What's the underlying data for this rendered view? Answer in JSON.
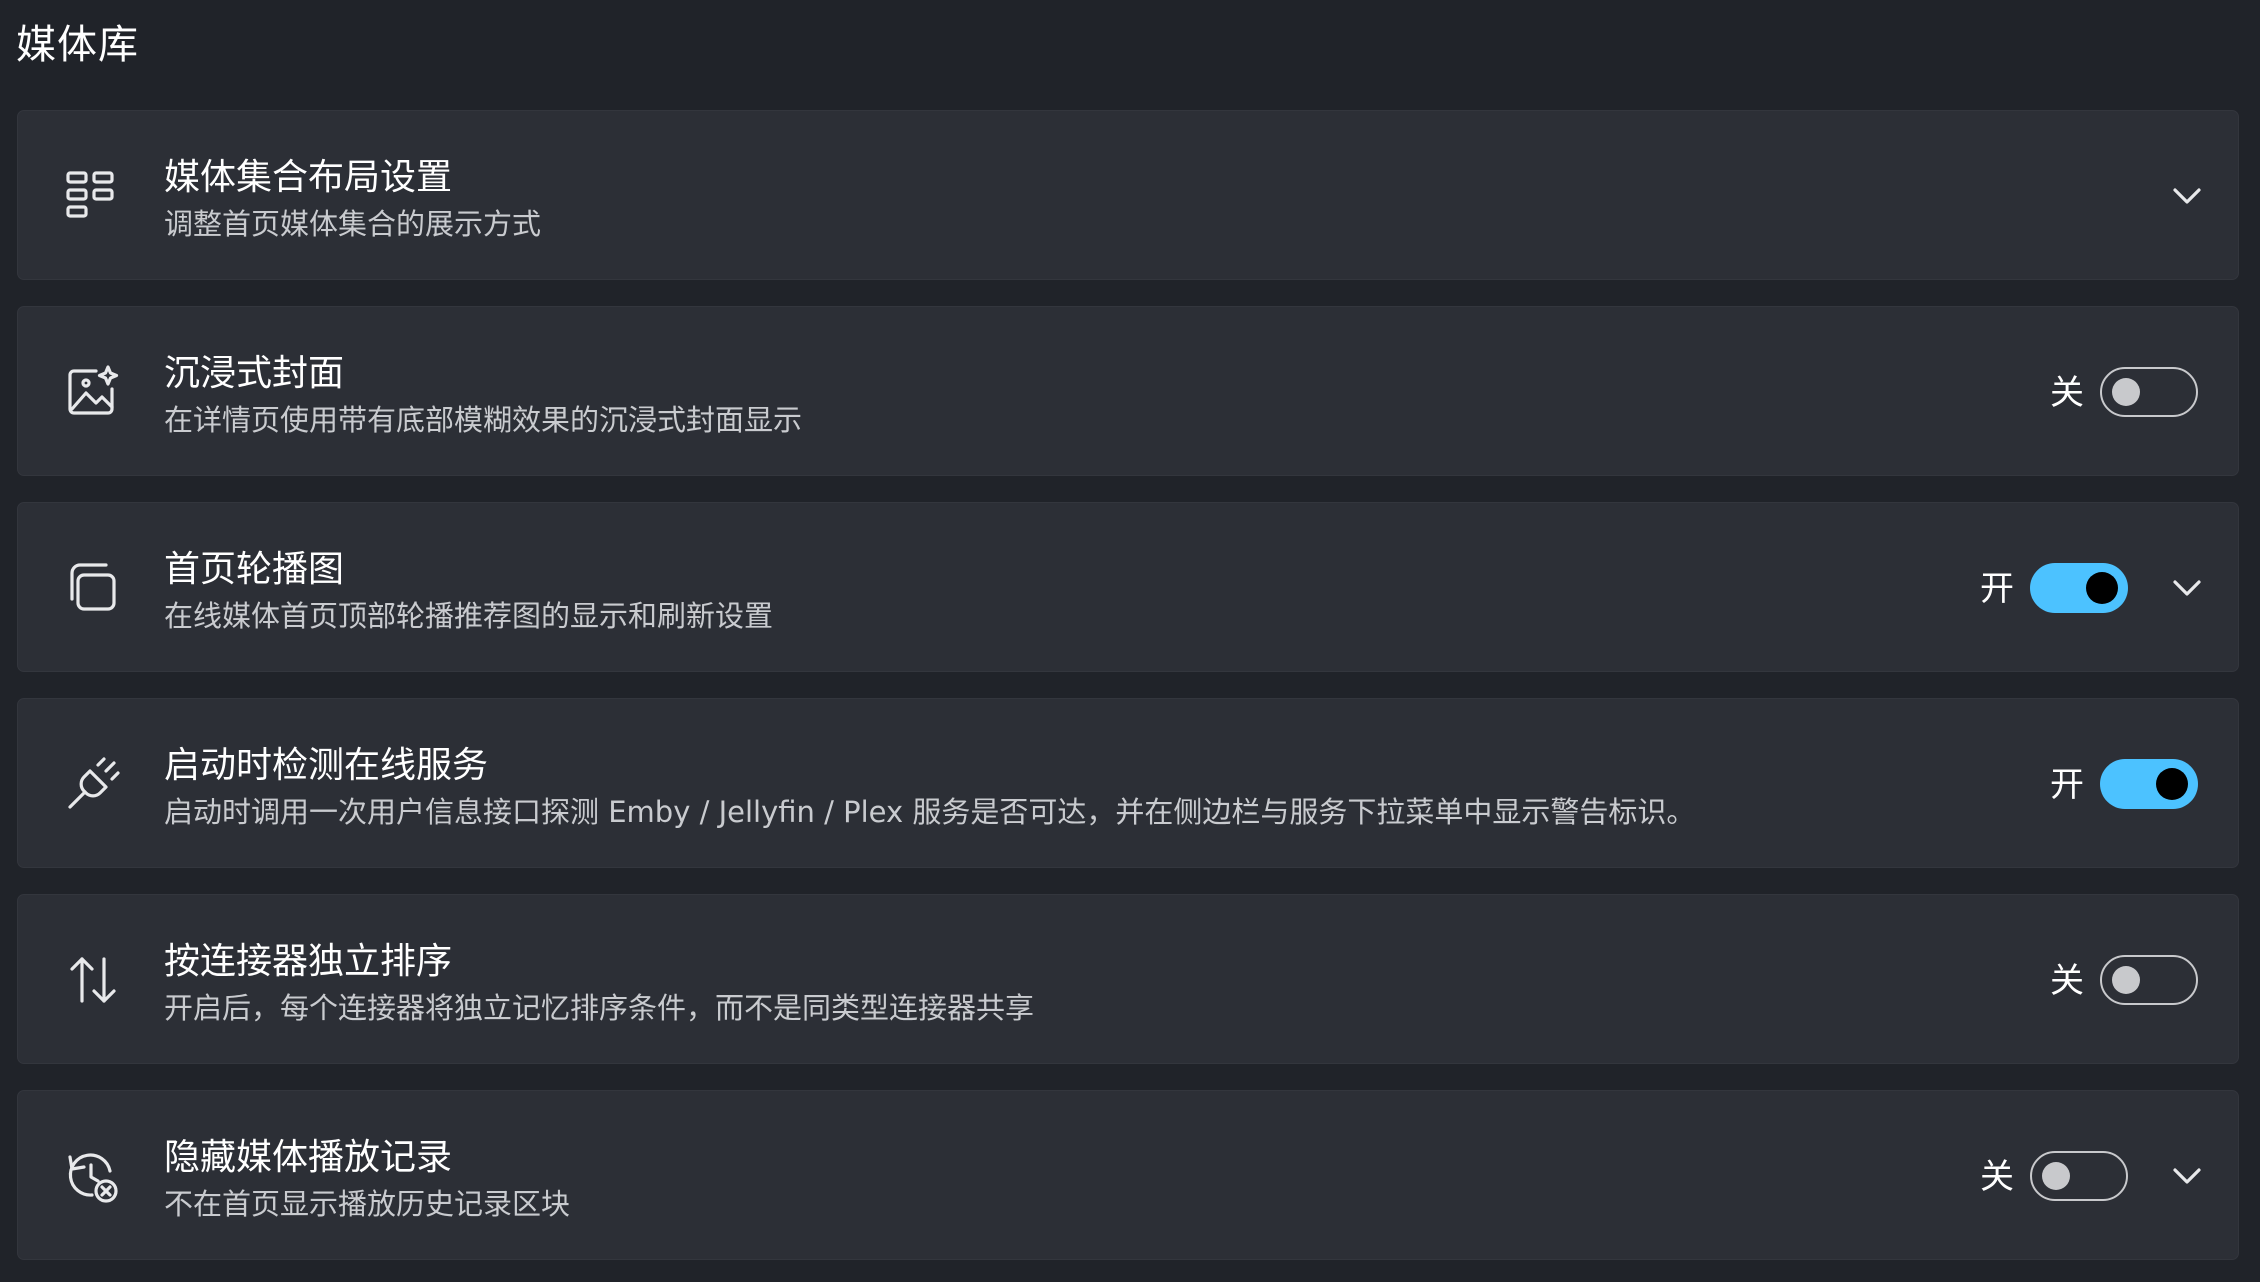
{
  "page": {
    "section_title": "媒体库"
  },
  "settings": [
    {
      "icon": "grid-layout-icon",
      "title": "媒体集合布局设置",
      "description": "调整首页媒体集合的展示方式",
      "has_toggle": false,
      "has_chevron": true
    },
    {
      "icon": "image-sparkle-icon",
      "title": "沉浸式封面",
      "description": "在详情页使用带有底部模糊效果的沉浸式封面显示",
      "has_toggle": true,
      "toggle_on": false,
      "state_label": "关",
      "has_chevron": false
    },
    {
      "icon": "stacked-windows-icon",
      "title": "首页轮播图",
      "description": "在线媒体首页顶部轮播推荐图的显示和刷新设置",
      "has_toggle": true,
      "toggle_on": true,
      "state_label": "开",
      "has_chevron": true
    },
    {
      "icon": "plug-connect-icon",
      "title": "启动时检测在线服务",
      "description": "启动时调用一次用户信息接口探测 Emby / Jellyfin / Plex 服务是否可达，并在侧边栏与服务下拉菜单中显示警告标识。",
      "has_toggle": true,
      "toggle_on": true,
      "state_label": "开",
      "has_chevron": false
    },
    {
      "icon": "sort-arrows-icon",
      "title": "按连接器独立排序",
      "description": "开启后，每个连接器将独立记忆排序条件，而不是同类型连接器共享",
      "has_toggle": true,
      "toggle_on": false,
      "state_label": "关",
      "has_chevron": false
    },
    {
      "icon": "history-dismiss-icon",
      "title": "隐藏媒体播放记录",
      "description": "不在首页显示播放历史记录区块",
      "has_toggle": true,
      "toggle_on": false,
      "state_label": "关",
      "has_chevron": true
    }
  ],
  "colors": {
    "background": "#202329",
    "card": "#2c2f36",
    "accent": "#4cc2ff",
    "text_primary": "#ffffff",
    "text_secondary": "#c9cbcf"
  }
}
